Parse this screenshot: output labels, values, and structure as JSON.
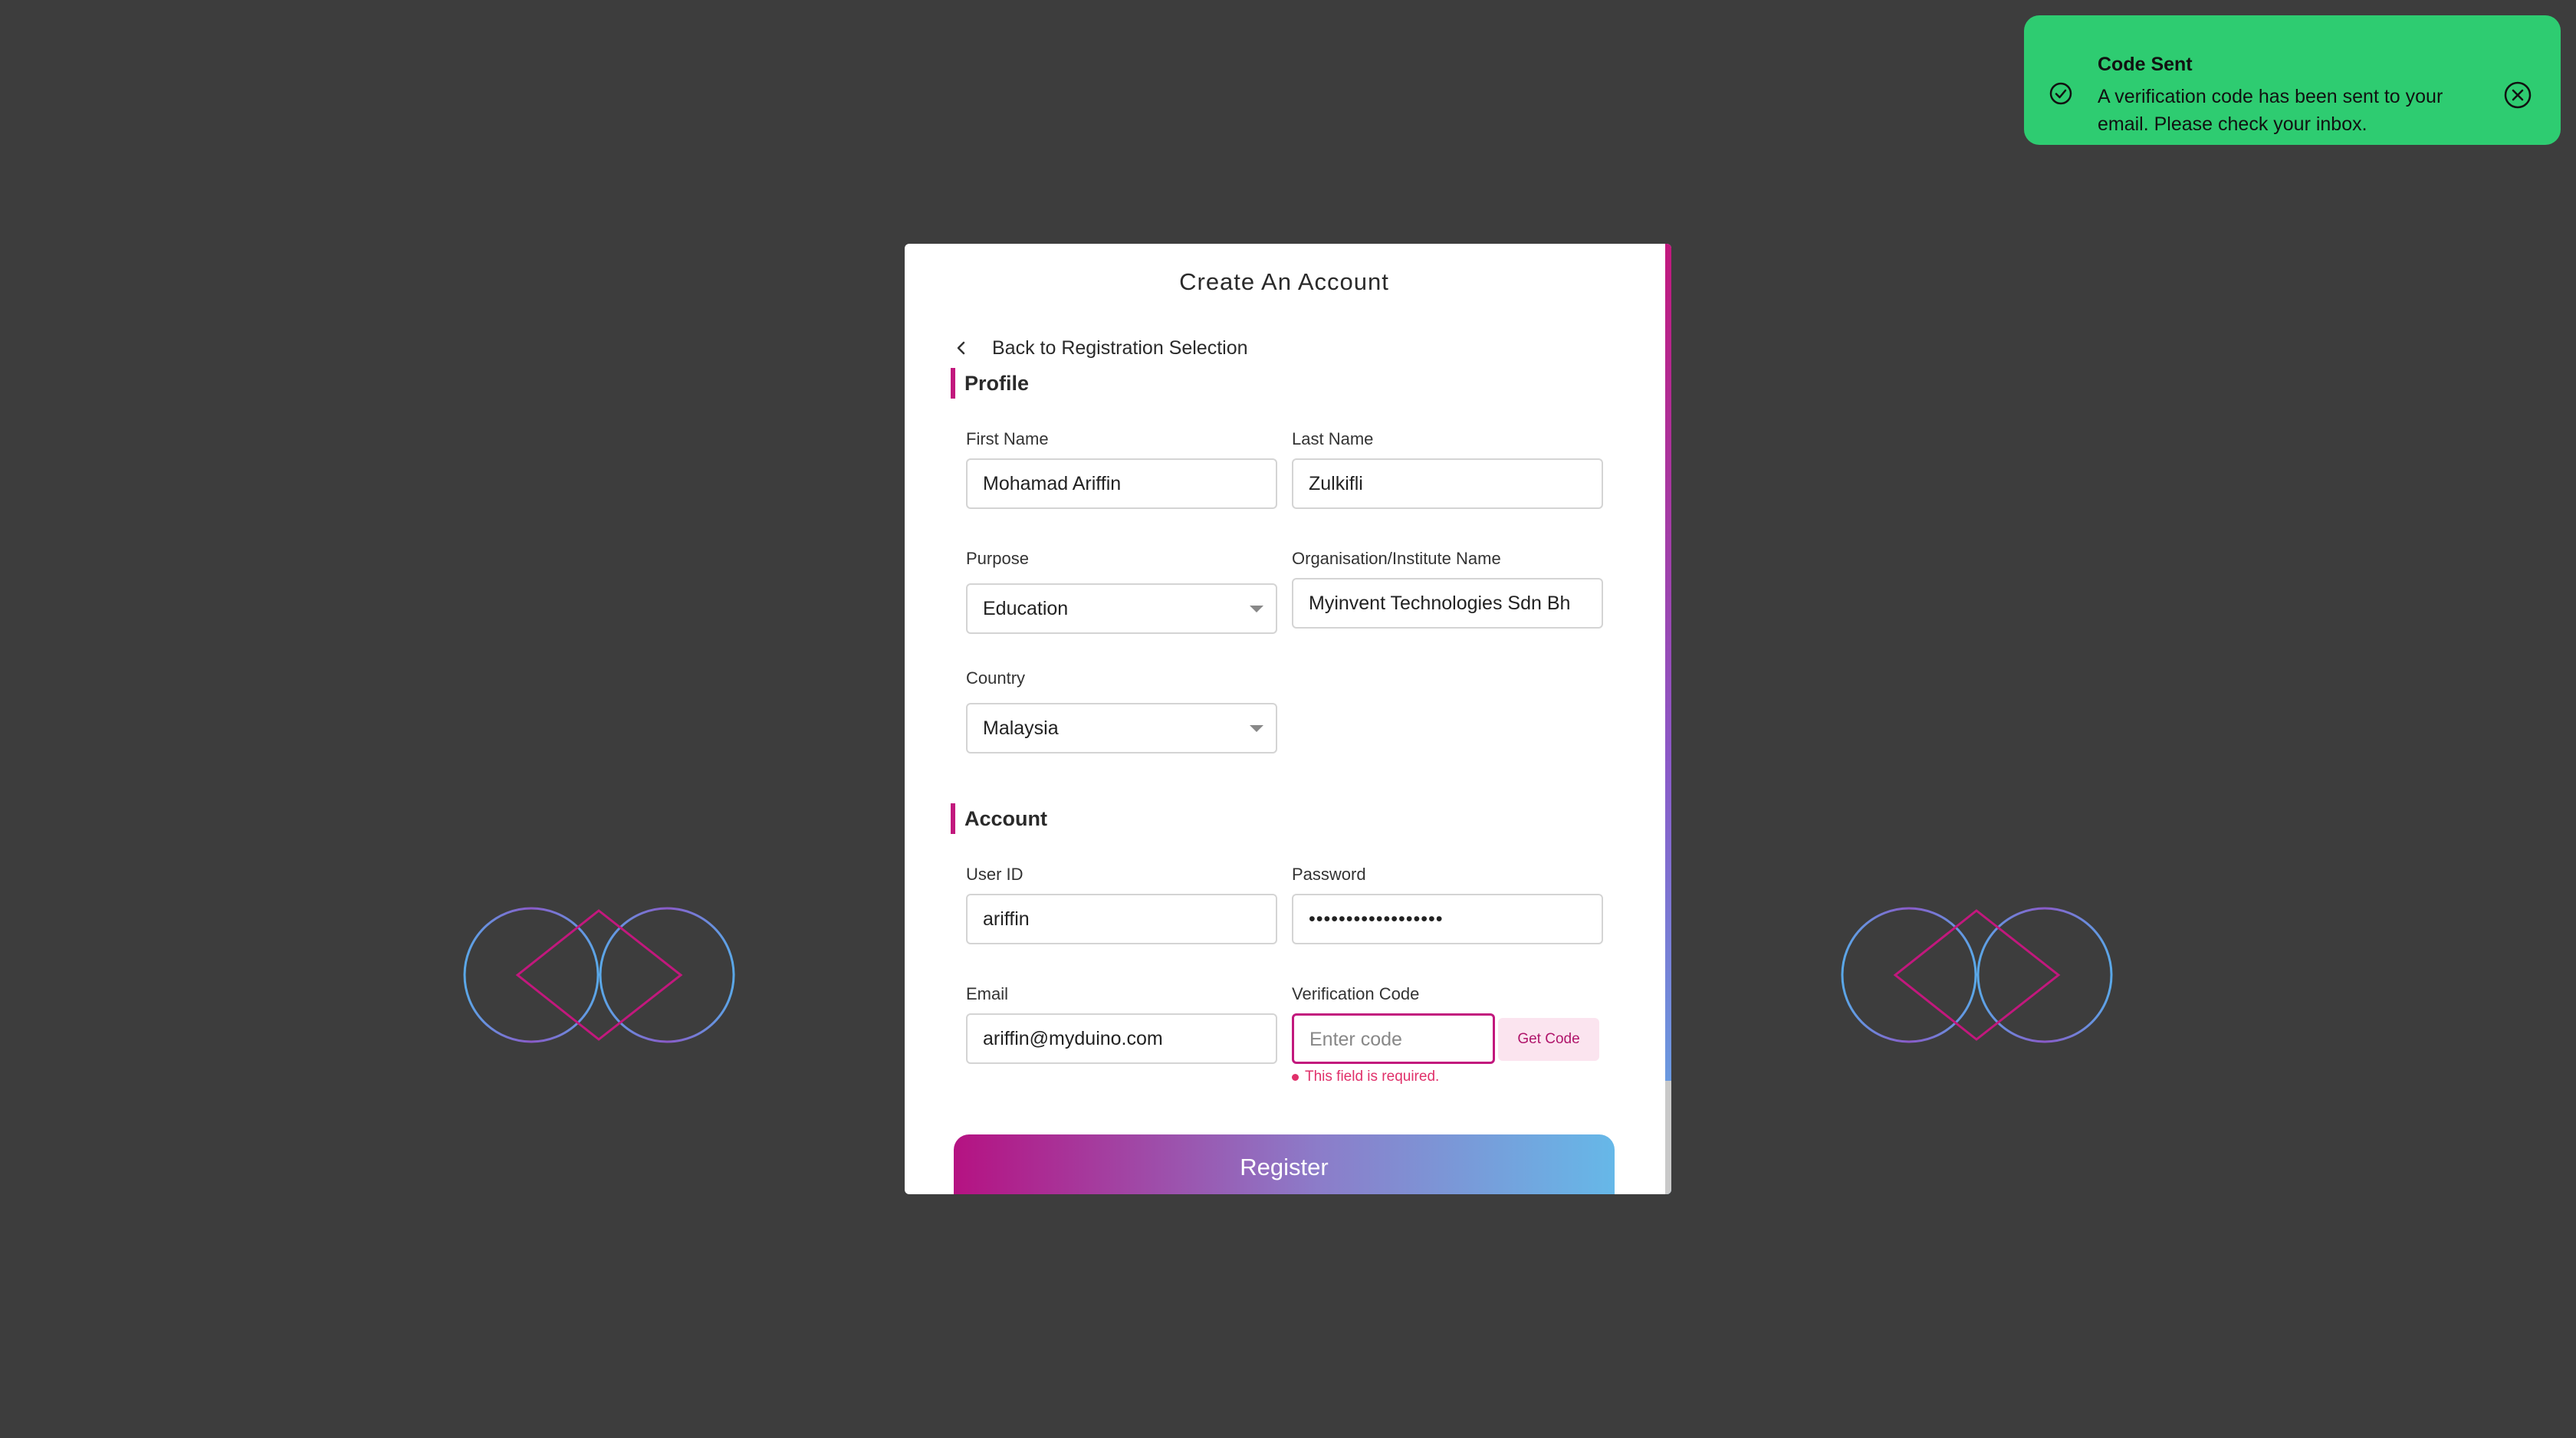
{
  "toast": {
    "title": "Code Sent",
    "message": "A verification code has been sent to your email. Please check your inbox.",
    "icon": "check-circle-icon",
    "close_icon": "close-circle-icon",
    "color": "#2ecc71"
  },
  "card": {
    "title": "Create An Account",
    "back_label": "Back to Registration Selection"
  },
  "profile": {
    "section_title": "Profile",
    "first_name_label": "First Name",
    "first_name_value": "Mohamad Ariffin",
    "last_name_label": "Last Name",
    "last_name_value": "Zulkifli",
    "purpose_label": "Purpose",
    "purpose_value": "Education",
    "org_label": "Organisation/Institute Name",
    "org_value": "Myinvent Technologies Sdn Bh",
    "country_label": "Country",
    "country_value": "Malaysia"
  },
  "account": {
    "section_title": "Account",
    "userid_label": "User ID",
    "userid_value": "ariffin",
    "password_label": "Password",
    "password_value": "••••••••••••••••••",
    "email_label": "Email",
    "email_value": "ariffin@myduino.com",
    "code_label": "Verification Code",
    "code_placeholder": "Enter code",
    "get_code_label": "Get Code",
    "code_error": "This field is required."
  },
  "register_label": "Register",
  "colors": {
    "accent": "#c2187d",
    "background": "#3d3d3d",
    "gradient_end": "#66b8e8"
  }
}
